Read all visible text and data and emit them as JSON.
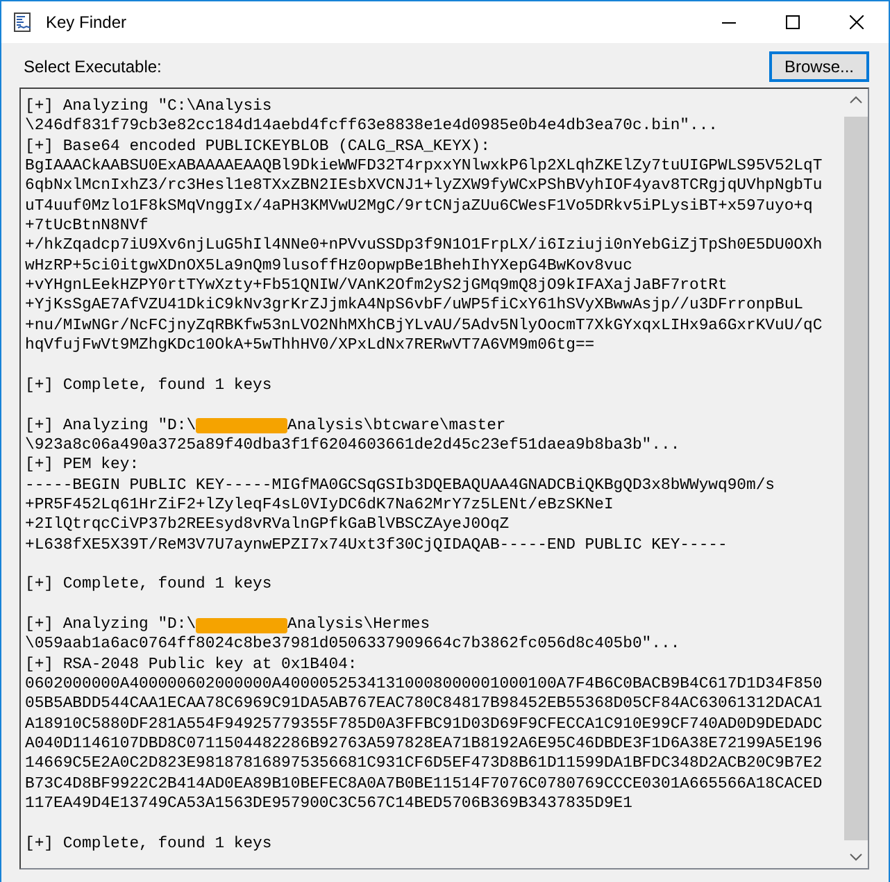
{
  "window": {
    "title": "Key Finder"
  },
  "executable": {
    "label": "Select Executable:",
    "button": "Browse..."
  },
  "output": {
    "lines": [
      {
        "kind": "text",
        "text": "[+] Analyzing \"C:\\Analysis"
      },
      {
        "kind": "text",
        "text": "\\246df831f79cb3e82cc184d14aebd4fcff63e8838e1e4d0985e0b4e4db3ea70c.bin\"..."
      },
      {
        "kind": "text",
        "text": "[+] Base64 encoded PUBLICKEYBLOB (CALG_RSA_KEYX):"
      },
      {
        "kind": "text",
        "text": "BgIAAACkAABSU0ExABAAAAEAAQBl9DkieWWFD32T4rpxxYNlwxkP6lp2XLqhZKElZy7tuUIGPWLS95V52LqT"
      },
      {
        "kind": "text",
        "text": "6qbNxlMcnIxhZ3/rc3Hesl1e8TXxZBN2IEsbXVCNJ1+lyZXW9fyWCxPShBVyhIOF4yav8TCRgjqUVhpNgbTu"
      },
      {
        "kind": "text",
        "text": "uT4uuf0Mzlo1F8kSMqVnggIx/4aPH3KMVwU2MgC/9rtCNjaZUu6CWesF1Vo5DRkv5iPLysiBT+x597uyo+q"
      },
      {
        "kind": "text",
        "text": "+7tUcBtnN8NVf"
      },
      {
        "kind": "text",
        "text": "+/hkZqadcp7iU9Xv6njLuG5hIl4NNe0+nPVvuSSDp3f9N1O1FrpLX/i6Iziuji0nYebGiZjTpSh0E5DU0OXh"
      },
      {
        "kind": "text",
        "text": "wHzRP+5ci0itgwXDnOX5La9nQm9lusoffHz0opwpBe1BhehIhYXepG4BwKov8vuc"
      },
      {
        "kind": "text",
        "text": "+vYHgnLEekHZPY0rtTYwXzty+Fb51QNIW/VAnK2Ofm2yS2jGMq9mQ8jO9kIFAXajJaBF7rotRt"
      },
      {
        "kind": "text",
        "text": "+YjKsSgAE7AfVZU41DkiC9kNv3grKrZJjmkA4NpS6vbF/uWP5fiCxY61hSVyXBwwAsjp//u3DFrronpBuL"
      },
      {
        "kind": "text",
        "text": "+nu/MIwNGr/NcFCjnyZqRBKfw53nLVO2NhMXhCBjYLvAU/5Adv5NlyOocmT7XkGYxqxLIHx9a6GxrKVuU/qC"
      },
      {
        "kind": "text",
        "text": "hqVfujFwVt9MZhgKDc10OkA+5wThhHV0/XPxLdNx7RERwVT7A6VM9m06tg=="
      },
      {
        "kind": "blank"
      },
      {
        "kind": "text",
        "text": "[+] Complete, found 1 keys"
      },
      {
        "kind": "blank"
      },
      {
        "kind": "redacted",
        "before": "[+] Analyzing \"D:\\",
        "after": "Analysis\\btcware\\master"
      },
      {
        "kind": "text",
        "text": "\\923a8c06a490a3725a89f40dba3f1f6204603661de2d45c23ef51daea9b8ba3b\"..."
      },
      {
        "kind": "text",
        "text": "[+] PEM key:"
      },
      {
        "kind": "text",
        "text": "-----BEGIN PUBLIC KEY-----MIGfMA0GCSqGSIb3DQEBAQUAA4GNADCBiQKBgQD3x8bWWywq90m/s"
      },
      {
        "kind": "text",
        "text": "+PR5F452Lq61HrZiF2+lZyleqF4sL0VIyDC6dK7Na62MrY7z5LENt/eBzSKNeI"
      },
      {
        "kind": "text",
        "text": "+2IlQtrqcCiVP37b2REEsyd8vRValnGPfkGaBlVBSCZAyeJ0OqZ"
      },
      {
        "kind": "text",
        "text": "+L638fXE5X39T/ReM3V7U7aynwEPZI7x74Uxt3f30CjQIDAQAB-----END PUBLIC KEY-----"
      },
      {
        "kind": "blank"
      },
      {
        "kind": "text",
        "text": "[+] Complete, found 1 keys"
      },
      {
        "kind": "blank"
      },
      {
        "kind": "redacted",
        "before": "[+] Analyzing \"D:\\",
        "after": "Analysis\\Hermes"
      },
      {
        "kind": "text",
        "text": "\\059aab1a6ac0764ff8024c8be37981d0506337909664c7b3862fc056d8c405b0\"..."
      },
      {
        "kind": "text",
        "text": "[+] RSA-2048 Public key at 0x1B404:"
      },
      {
        "kind": "text",
        "text": "0602000000A400000602000000A40000525341310008000001000100A7F4B6C0BACB9B4C617D1D34F850"
      },
      {
        "kind": "text",
        "text": "05B5ABDD544CAA1ECAA78C6969C91DA5AB767EAC780C84817B98452EB55368D05CF84AC63061312DACA1"
      },
      {
        "kind": "text",
        "text": "A18910C5880DF281A554F94925779355F785D0A3FFBC91D03D69F9CFECCA1C910E99CF740AD0D9DEDADC"
      },
      {
        "kind": "text",
        "text": "A040D1146107DBD8C0711504482286B92763A597828EA71B8192A6E95C46DBDE3F1D6A38E72199A5E196"
      },
      {
        "kind": "text",
        "text": "14669C5E2A0C2D823E981878168975356681C931CF6D5EF473D8B61D11599DA1BFDC348D2ACB20C9B7E2"
      },
      {
        "kind": "text",
        "text": "B73C4D8BF9922C2B414AD0EA89B10BEFEC8A0A7B0BE11514F7076C0780769CCCE0301A665566A18CACED"
      },
      {
        "kind": "text",
        "text": "117EA49D4E13749CA53A1563DE957900C3C567C14BED5706B369B3437835D9E1"
      },
      {
        "kind": "blank"
      },
      {
        "kind": "text",
        "text": "[+] Complete, found 1 keys"
      }
    ]
  }
}
